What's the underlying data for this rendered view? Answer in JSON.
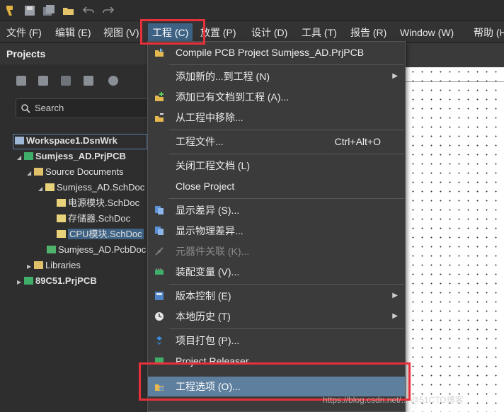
{
  "menubar": {
    "items": [
      "文件 (F)",
      "编辑 (E)",
      "视图 (V)",
      "工程 (C)",
      "放置 (P)",
      "设计 (D)",
      "工具 (T)",
      "报告 (R)",
      "Window (W)",
      "帮助 (H)"
    ],
    "active_index": 3
  },
  "panel": {
    "title": "Projects",
    "search_placeholder": "Search",
    "tree": [
      {
        "label": "Workspace1.DsnWrk",
        "icon": "workspace-icon"
      },
      {
        "label": "Sumjess_AD.PrjPCB",
        "icon": "pcb-project-icon"
      },
      {
        "label": "Source Documents",
        "icon": "folder-icon"
      },
      {
        "label": "Sumjess_AD.SchDoc",
        "icon": "schematic-icon"
      },
      {
        "label": "电源模块.SchDoc",
        "icon": "schematic-icon"
      },
      {
        "label": "存储器.SchDoc",
        "icon": "schematic-icon"
      },
      {
        "label": "CPU模块.SchDoc",
        "icon": "schematic-icon"
      },
      {
        "label": "Sumjess_AD.PcbDoc",
        "icon": "pcb-doc-icon"
      },
      {
        "label": "Libraries",
        "icon": "folder-icon"
      },
      {
        "label": "89C51.PrjPCB",
        "icon": "pcb-project-icon"
      }
    ]
  },
  "dropdown": {
    "items": [
      {
        "label": "Compile PCB Project Sumjess_AD.PrjPCB",
        "shortcut": "",
        "icon": "compile-icon"
      },
      {
        "label": "添加新的...到工程 (N)",
        "shortcut": "",
        "icon": ""
      },
      {
        "label": "添加已有文档到工程 (A)...",
        "shortcut": "",
        "icon": "add-existing-icon"
      },
      {
        "label": "从工程中移除...",
        "shortcut": "",
        "icon": "remove-icon"
      },
      {
        "label": "工程文件...",
        "shortcut": "Ctrl+Alt+O",
        "icon": ""
      },
      {
        "label": "关闭工程文档 (L)",
        "shortcut": "",
        "icon": ""
      },
      {
        "label": "Close Project",
        "shortcut": "",
        "icon": ""
      },
      {
        "label": "显示差异 (S)...",
        "shortcut": "",
        "icon": "show-differences-icon"
      },
      {
        "label": "显示物理差异...",
        "shortcut": "",
        "icon": "physical-differences-icon"
      },
      {
        "label": "元器件关联 (K)...",
        "shortcut": "",
        "icon": "component-links-icon"
      },
      {
        "label": "装配变量 (V)...",
        "shortcut": "",
        "icon": "variants-icon"
      },
      {
        "label": "版本控制 (E)",
        "shortcut": "",
        "icon": "version-control-icon"
      },
      {
        "label": "本地历史 (T)",
        "shortcut": "",
        "icon": "local-history-icon"
      },
      {
        "label": "项目打包 (P)...",
        "shortcut": "",
        "icon": "package-icon"
      },
      {
        "label": "Project Releaser...",
        "shortcut": "",
        "icon": "releaser-icon"
      },
      {
        "label": "工程选项 (O)...",
        "shortcut": "",
        "icon": "project-options-icon"
      }
    ]
  },
  "watermark": "https://blog.csdn.net/... @51CTO博客",
  "colors": {
    "highlight": "#3e6283",
    "annotation": "#e8303a"
  }
}
